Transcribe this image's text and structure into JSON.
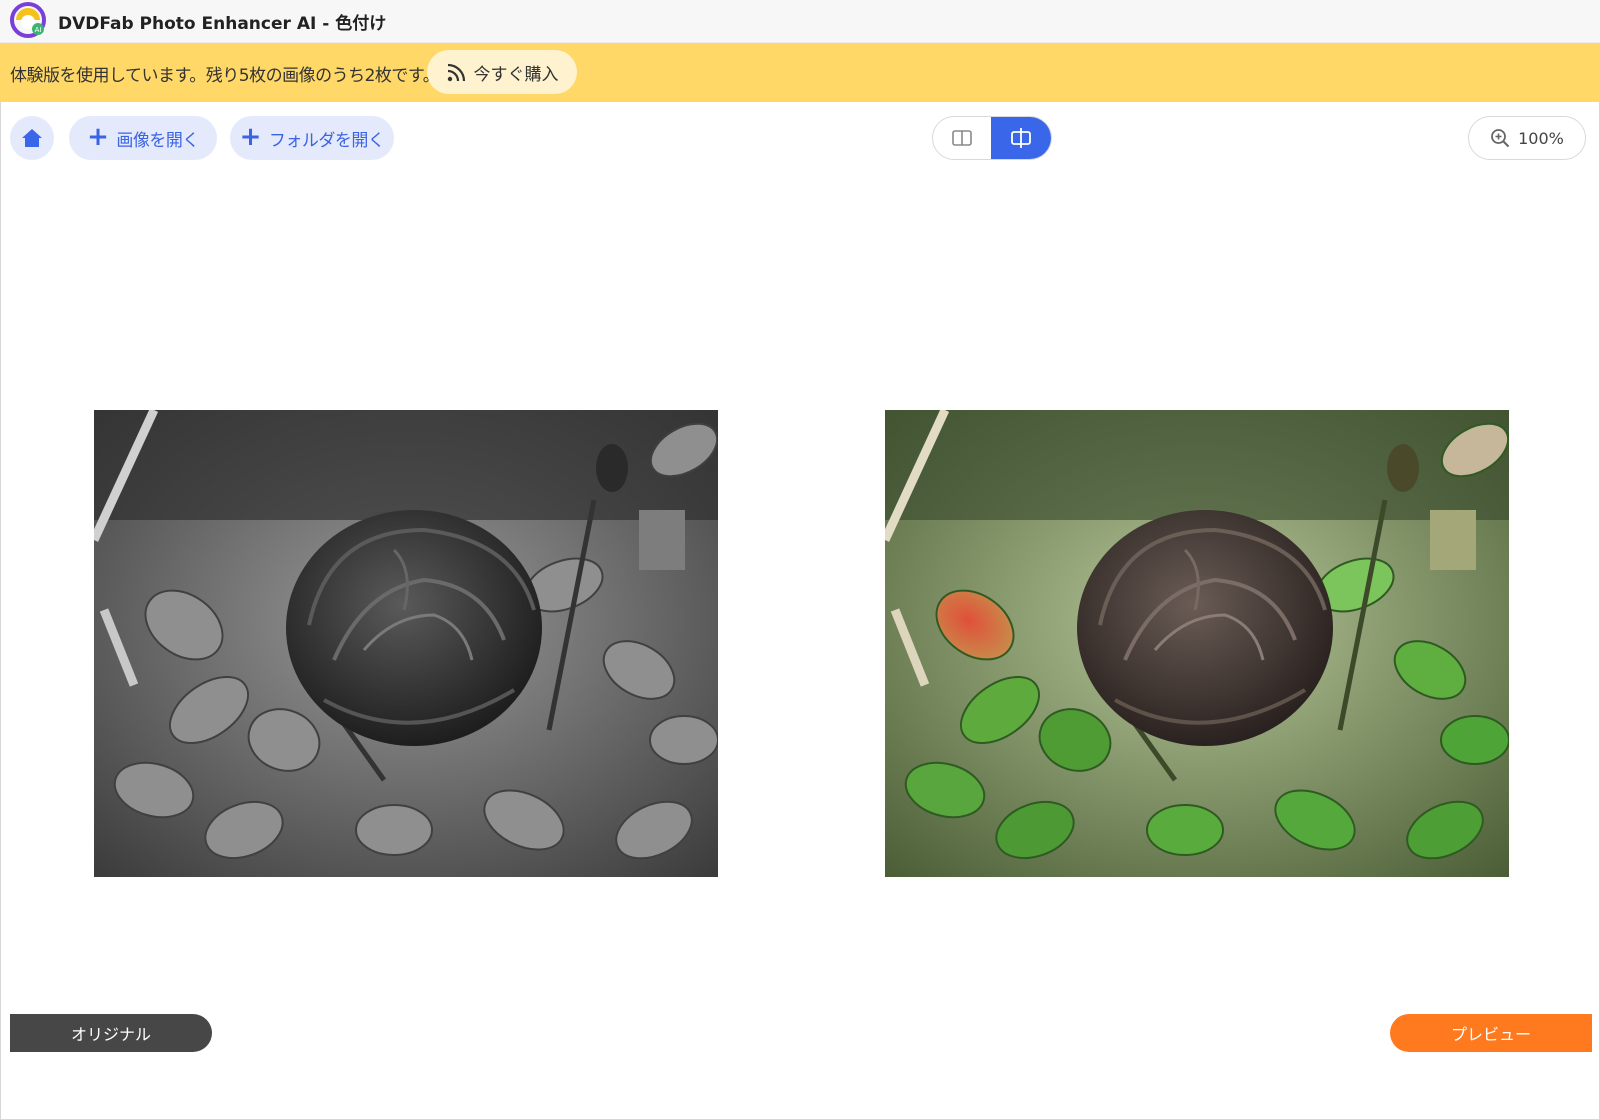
{
  "app": {
    "title": "DVDFab Photo Enhancer AI - 色付け"
  },
  "trial_banner": {
    "text": "体験版を使用しています。残り5枚の画像のうち2枚です。",
    "buy_label": "今すぐ購入"
  },
  "toolbar": {
    "open_image_label": "画像を開く",
    "open_folder_label": "フォルダを開く",
    "view_mode_selected": "side-by-side",
    "zoom_label": "100%"
  },
  "viewer": {
    "original_label": "オリジナル",
    "preview_label": "プレビュー"
  },
  "colors": {
    "accent": "#3a67ea",
    "banner": "#ffd867",
    "preview_tag": "#ff7a1f",
    "original_tag": "#474747"
  },
  "icons": [
    "app-logo-icon",
    "rss-icon",
    "home-icon",
    "plus-icon",
    "split-view-icon",
    "side-by-side-icon",
    "zoom-in-icon"
  ]
}
